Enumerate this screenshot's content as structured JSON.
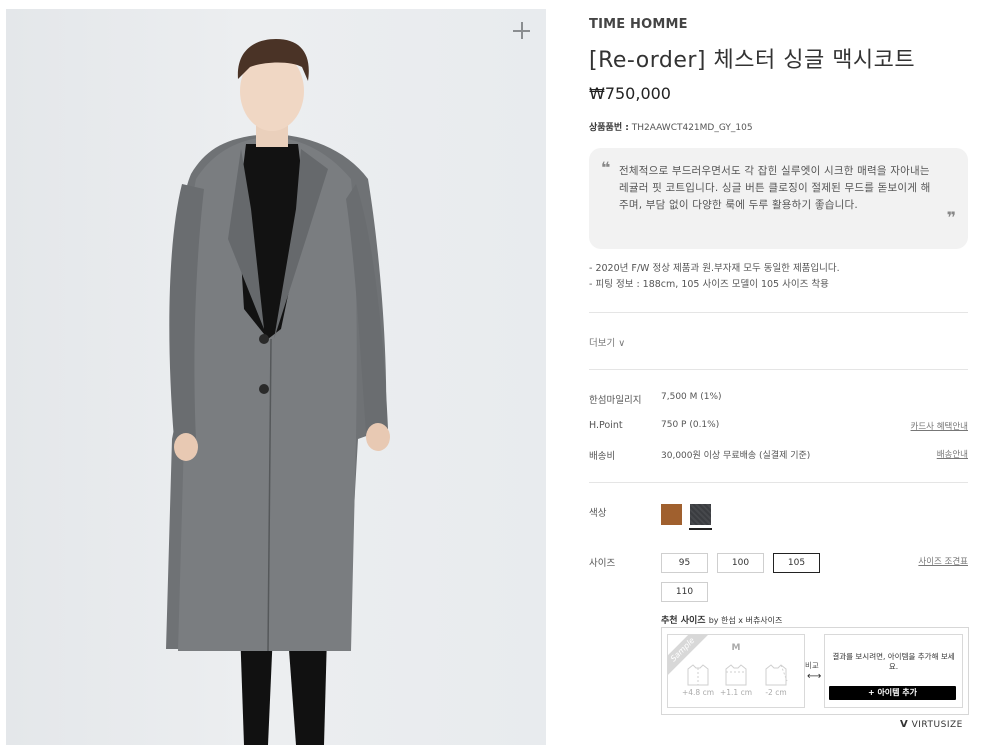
{
  "brand": "TIME HOMME",
  "product": {
    "title": "[Re-order] 체스터 싱글 맥시코트",
    "price": "₩750,000",
    "sku_label": "상품품번 :",
    "sku_value": "TH2AAWCT421MD_GY_105"
  },
  "description": {
    "open_quote": "❝",
    "close_quote": "❞",
    "text": "전체적으로 부드러우면서도 각 잡힌 실루엣이 시크한 매력을 자아내는 레귤러 핏 코트입니다. 싱글 버튼 클로징이 절제된 무드를 돋보이게 해주며, 부담 없이 다양한 룩에 두루 활용하기 좋습니다."
  },
  "notes": [
    "- 2020년 F/W 정상 제품과 원.부자재 모두 동일한 제품입니다.",
    "- 피팅 정보 : 188cm, 105 사이즈 모델이 105 사이즈 착용"
  ],
  "more_label": "더보기 ∨",
  "benefits": {
    "mileage_label": "한섬마일리지",
    "mileage_value": "7,500 M (1%)",
    "hpoint_label": "H.Point",
    "hpoint_value": "750 P (0.1%)",
    "hpoint_link": "카드사 혜택안내",
    "shipping_label": "배송비",
    "shipping_value": "30,000원 이상 무료배송 (실결제 기준)",
    "shipping_link": "배송안내"
  },
  "color": {
    "label": "색상",
    "swatches": [
      {
        "name": "brown",
        "color": "#a0602e",
        "selected": false
      },
      {
        "name": "grey",
        "color": "#3c3e42",
        "selected": true
      }
    ]
  },
  "size": {
    "label": "사이즈",
    "options": [
      "95",
      "100",
      "105",
      "110"
    ],
    "selected": "105",
    "chart_link": "사이즈 조견표"
  },
  "recommend": {
    "title": "추천 사이즈",
    "by": "by 한섬 x 버츄사이즈",
    "sample_label": "Sample",
    "sample_size": "M",
    "diffs": [
      "+4.8 cm",
      "+1.1 cm",
      "-2 cm"
    ],
    "compare": "비교",
    "compare_arrow": "⟷",
    "add_message": "결과를 보시려면, 아이템을 추가해 보세요.",
    "add_button": "+ 아이템 추가"
  },
  "virtusize": "VIRTUSIZE",
  "virtusize_mark": "V"
}
